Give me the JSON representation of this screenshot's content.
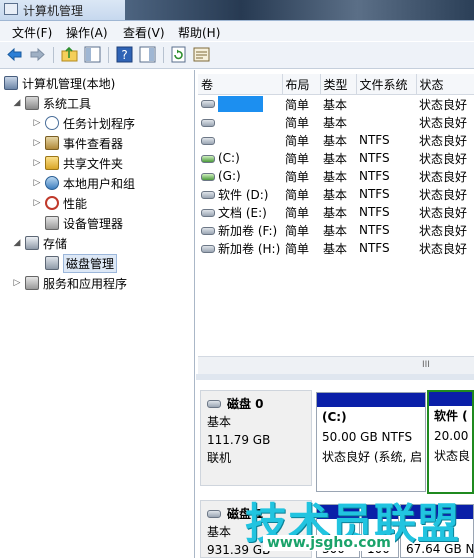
{
  "window": {
    "title": "计算机管理"
  },
  "menu": {
    "file": "文件(F)",
    "action": "操作(A)",
    "view": "查看(V)",
    "help": "帮助(H)"
  },
  "tree": {
    "root": "计算机管理(本地)",
    "system_tools": "系统工具",
    "task_scheduler": "任务计划程序",
    "event_viewer": "事件查看器",
    "shared_folders": "共享文件夹",
    "local_users": "本地用户和组",
    "performance": "性能",
    "device_manager": "设备管理器",
    "storage": "存储",
    "disk_management": "磁盘管理",
    "services_apps": "服务和应用程序"
  },
  "volumes": {
    "headers": [
      "卷",
      "布局",
      "类型",
      "文件系统",
      "状态"
    ],
    "rows": [
      {
        "name": "",
        "layout": "简单",
        "type": "基本",
        "fs": "",
        "status": "状态良好"
      },
      {
        "name": "",
        "layout": "简单",
        "type": "基本",
        "fs": "",
        "status": "状态良好"
      },
      {
        "name": "",
        "layout": "简单",
        "type": "基本",
        "fs": "NTFS",
        "status": "状态良好"
      },
      {
        "name": "(C:)",
        "layout": "简单",
        "type": "基本",
        "fs": "NTFS",
        "status": "状态良好"
      },
      {
        "name": "(G:)",
        "layout": "简单",
        "type": "基本",
        "fs": "NTFS",
        "status": "状态良好"
      },
      {
        "name": "软件 (D:)",
        "layout": "简单",
        "type": "基本",
        "fs": "NTFS",
        "status": "状态良好"
      },
      {
        "name": "文档 (E:)",
        "layout": "简单",
        "type": "基本",
        "fs": "NTFS",
        "status": "状态良好"
      },
      {
        "name": "新加卷 (F:)",
        "layout": "简单",
        "type": "基本",
        "fs": "NTFS",
        "status": "状态良好"
      },
      {
        "name": "新加卷 (H:)",
        "layout": "简单",
        "type": "基本",
        "fs": "NTFS",
        "status": "状态良好"
      }
    ],
    "scroll_glyph": "III"
  },
  "disks": [
    {
      "name": "磁盘 0",
      "type": "基本",
      "size": "111.79 GB",
      "status": "联机",
      "partitions": [
        {
          "name": "(C:)",
          "size": "50.00 GB NTFS",
          "status": "状态良好 (系统, 启"
        },
        {
          "name": "软件 (",
          "size": "20.00",
          "status": "状态良"
        }
      ]
    },
    {
      "name": "磁盘 1",
      "type": "基本",
      "size": "931.39 GB",
      "partitions": [
        {
          "size": "300"
        },
        {
          "size": "100"
        },
        {
          "size": "67.64 GB N"
        }
      ]
    }
  ],
  "watermark": {
    "brand": "技术员联盟",
    "url": "www.jsgho.com"
  }
}
